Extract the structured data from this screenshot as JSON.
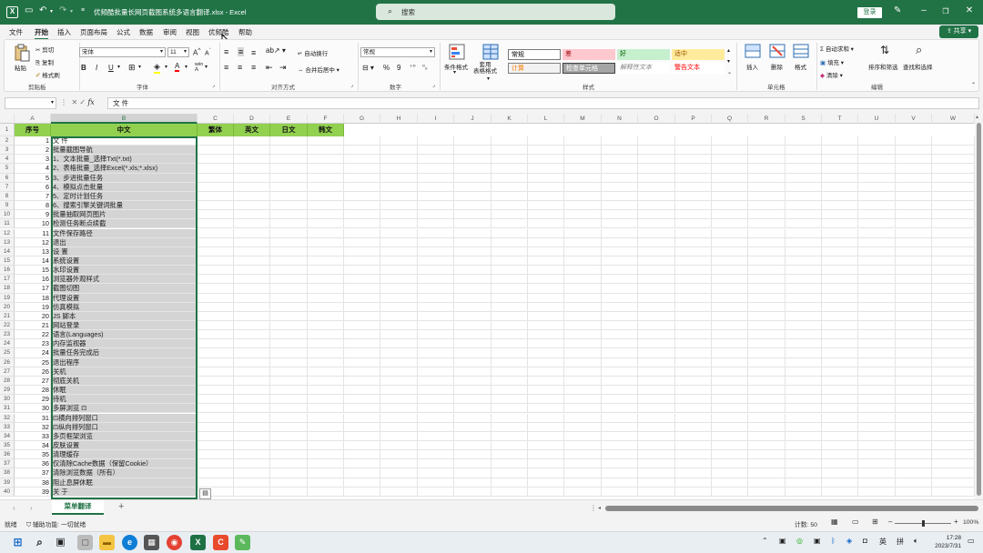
{
  "window": {
    "app_icon": "X",
    "filename": "优频酷批量长网页截图系统多语言翻译.xlsx",
    "app_name": "Excel",
    "search_placeholder": "搜索",
    "login_label": "登录",
    "share_label": "共享"
  },
  "quick_access_icons": [
    "save-icon",
    "undo-icon",
    "redo-icon",
    "customize-icon"
  ],
  "menu_tabs": [
    "文件",
    "开始",
    "插入",
    "页面布局",
    "公式",
    "数据",
    "审阅",
    "视图",
    "优频酷",
    "帮助"
  ],
  "active_tab": "开始",
  "ribbon": {
    "clipboard": {
      "paste": "粘贴",
      "cut": "剪切",
      "copy": "复制",
      "format_painter": "格式刷",
      "label": "剪贴板"
    },
    "font": {
      "name": "宋体",
      "size": "11",
      "grow": "A",
      "shrink": "A",
      "bold": "B",
      "italic": "I",
      "underline": "U",
      "label": "字体",
      "font_color_letter": "A",
      "highlight_letter": "A",
      "phonetic_label": "wén"
    },
    "alignment": {
      "wrap_text": "自动换行",
      "merge_center": "合并后居中",
      "label": "对齐方式"
    },
    "number": {
      "format": "常规",
      "percent": "%",
      "comma": "9",
      "label": "数字"
    },
    "styles": {
      "conditional_formatting": "条件格式",
      "format_as_table": "套用\n表格格式",
      "label": "样式",
      "cells": [
        {
          "text": "常规",
          "bg": "#ffffff",
          "color": "#000000",
          "border": "#777777"
        },
        {
          "text": "差",
          "bg": "#ffc7ce",
          "color": "#9c0006",
          "border": ""
        },
        {
          "text": "好",
          "bg": "#c6efce",
          "color": "#006100",
          "border": ""
        },
        {
          "text": "适中",
          "bg": "#ffeb9c",
          "color": "#9c5700",
          "border": ""
        },
        {
          "text": "计算",
          "bg": "#f2f2f2",
          "color": "#fa7d00",
          "border": "#7f7f7f"
        },
        {
          "text": "检查单元格",
          "bg": "#a5a5a5",
          "color": "#ffffff",
          "border": "#3f3f3f"
        },
        {
          "text": "解释性文本",
          "bg": "#ffffff",
          "color": "#7f7f7f",
          "border": ""
        },
        {
          "text": "警告文本",
          "bg": "#ffffff",
          "color": "#ff0000",
          "border": ""
        }
      ]
    },
    "cells_group": {
      "insert": "插入",
      "delete": "删除",
      "format": "格式",
      "label": "单元格"
    },
    "editing": {
      "autosum": "自动求和",
      "fill": "填充",
      "clear": "清除",
      "sort_filter": "排序和筛选",
      "find_select": "查找和选择",
      "label": "编辑"
    }
  },
  "formula_bar": {
    "name_box": "",
    "fx": "fx",
    "content": "文 件"
  },
  "columns": [
    "A",
    "B",
    "C",
    "D",
    "E",
    "F",
    "G",
    "H",
    "I",
    "J",
    "K",
    "L",
    "M",
    "N",
    "O",
    "P",
    "Q",
    "R",
    "S",
    "T",
    "U",
    "V",
    "W"
  ],
  "selected_column": "B",
  "header_row": [
    "序号",
    "中文",
    "繁体",
    "英文",
    "日文",
    "韩文"
  ],
  "rows": [
    {
      "n": "1",
      "zh": "文  件"
    },
    {
      "n": "2",
      "zh": "批量截图导航"
    },
    {
      "n": "3",
      "zh": "1、文本批量_选择Txt(*.txt)"
    },
    {
      "n": "4",
      "zh": "2、表格批量_选择Excel(*.xls;*.xlsx)"
    },
    {
      "n": "5",
      "zh": "3、步进批量任务"
    },
    {
      "n": "6",
      "zh": "4、模拟点击批量"
    },
    {
      "n": "7",
      "zh": "5、定时计划任务"
    },
    {
      "n": "8",
      "zh": "6、搜索引擎关键词批量"
    },
    {
      "n": "9",
      "zh": "批量抽取网页图片"
    },
    {
      "n": "10",
      "zh": "检测任务断点续截"
    },
    {
      "n": "11",
      "zh": "文件保存路径"
    },
    {
      "n": "12",
      "zh": "退出"
    },
    {
      "n": "13",
      "zh": "设  置"
    },
    {
      "n": "14",
      "zh": "系统设置"
    },
    {
      "n": "15",
      "zh": "水印设置"
    },
    {
      "n": "16",
      "zh": "浏览器外观样式"
    },
    {
      "n": "17",
      "zh": "截图切图"
    },
    {
      "n": "18",
      "zh": "代理设置"
    },
    {
      "n": "19",
      "zh": "仿真模拟"
    },
    {
      "n": "20",
      "zh": "JS 脚本"
    },
    {
      "n": "21",
      "zh": "网站登录"
    },
    {
      "n": "22",
      "zh": "语言(Languages)"
    },
    {
      "n": "23",
      "zh": "内存监视器"
    },
    {
      "n": "24",
      "zh": "批量任务完成后"
    },
    {
      "n": "25",
      "zh": "退出程序"
    },
    {
      "n": "26",
      "zh": "关机"
    },
    {
      "n": "27",
      "zh": "彻底关机"
    },
    {
      "n": "28",
      "zh": "休眠"
    },
    {
      "n": "29",
      "zh": "待机"
    },
    {
      "n": "30",
      "zh": "多屏浏览  ⊡"
    },
    {
      "n": "31",
      "zh": "⊡横向排列窗口"
    },
    {
      "n": "32",
      "zh": "⊡纵向排列窗口"
    },
    {
      "n": "33",
      "zh": "多页框架浏览"
    },
    {
      "n": "34",
      "zh": "皮肤设置"
    },
    {
      "n": "35",
      "zh": "清理缓存"
    },
    {
      "n": "36",
      "zh": "仅清除Cache数据（保留Cookie）"
    },
    {
      "n": "37",
      "zh": "清除浏览数据（所有）"
    },
    {
      "n": "38",
      "zh": "阻止息屏休眠"
    },
    {
      "n": "39",
      "zh": "关  于"
    }
  ],
  "sheet_tab": "菜单翻译",
  "status": {
    "ready": "就绪",
    "accessibility": "辅助功能: 一切就绪",
    "count": "计数: 50",
    "zoom": "100%"
  },
  "taskbar": {
    "ime_lang": "英",
    "ime_mode": "拼",
    "time": "17:28",
    "date": "2023/7/31"
  }
}
